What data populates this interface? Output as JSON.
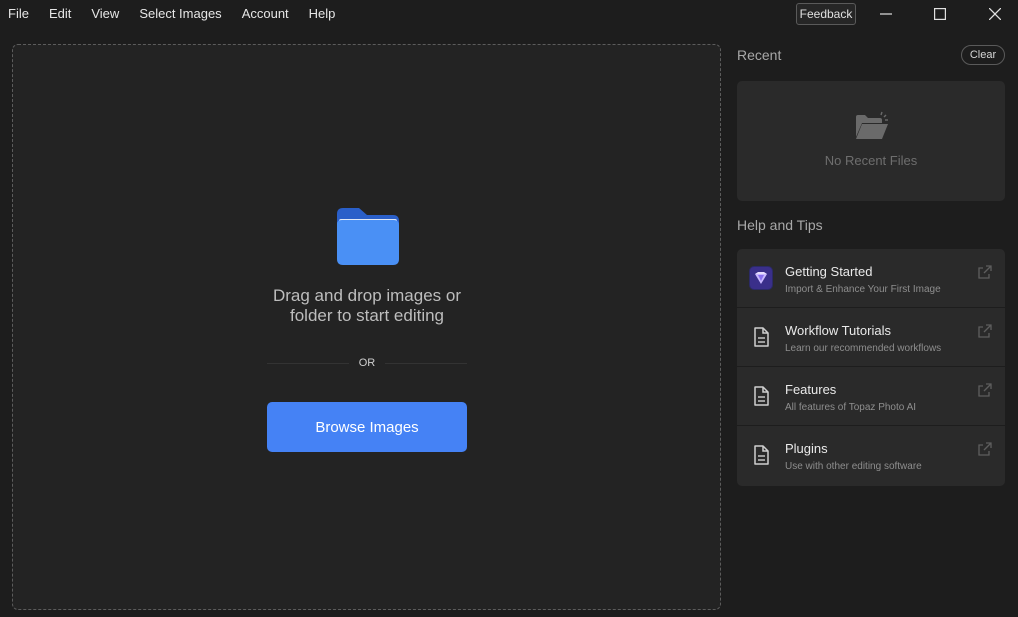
{
  "menu": {
    "items": [
      "File",
      "Edit",
      "View",
      "Select Images",
      "Account",
      "Help"
    ]
  },
  "titlebar": {
    "feedback_label": "Feedback",
    "controls": [
      "minimize-icon",
      "maximize-icon",
      "close-icon"
    ]
  },
  "dropzone": {
    "icon": "folder-icon",
    "line1": "Drag and drop images or",
    "line2": "folder to start editing",
    "or_label": "OR",
    "browse_label": "Browse Images"
  },
  "recent": {
    "title": "Recent",
    "clear_label": "Clear",
    "empty_icon": "open-folder-icon",
    "empty_text": "No Recent Files"
  },
  "help": {
    "title": "Help and Tips",
    "items": [
      {
        "title": "Getting Started",
        "subtitle": "Import & Enhance Your First Image",
        "icon": "topaz-gem-icon"
      },
      {
        "title": "Workflow Tutorials",
        "subtitle": "Learn our recommended workflows",
        "icon": "document-icon"
      },
      {
        "title": "Features",
        "subtitle": "All features of Topaz Photo AI",
        "icon": "document-icon"
      },
      {
        "title": "Plugins",
        "subtitle": "Use with other editing software",
        "icon": "document-icon"
      }
    ]
  },
  "colors": {
    "accent": "#4582f5",
    "background": "#1d1d1d",
    "panel": "#2a2a2a"
  }
}
